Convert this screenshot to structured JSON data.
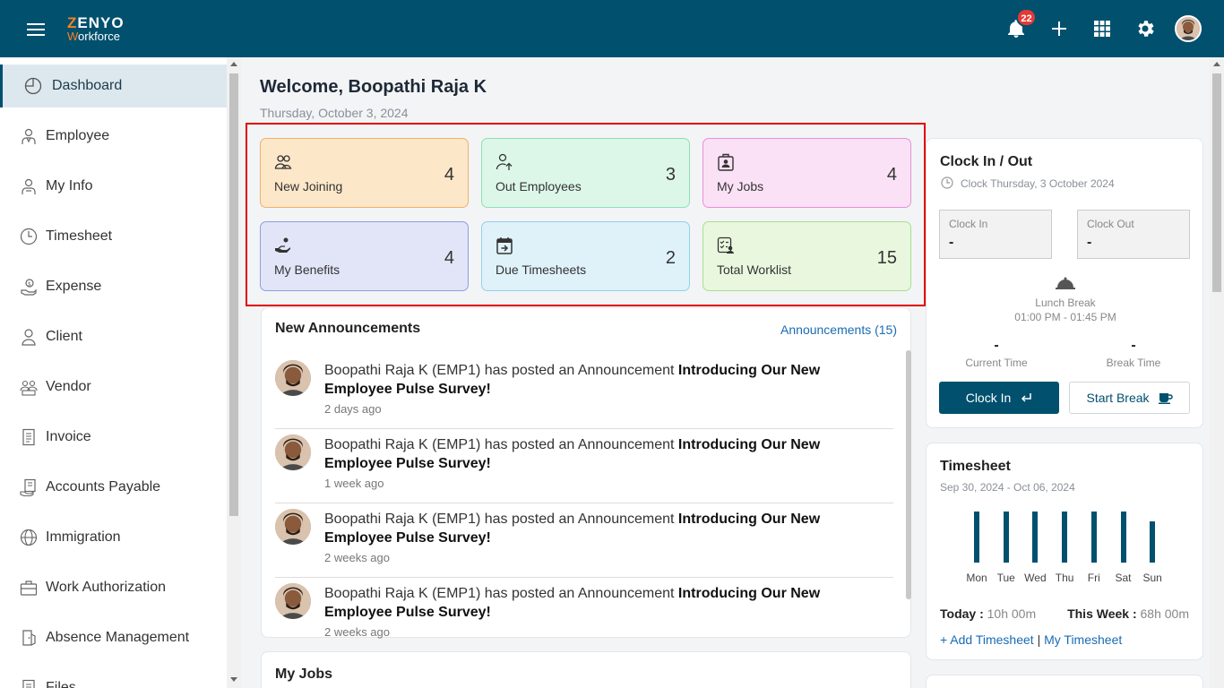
{
  "app": {
    "brand_top": "ZENYO",
    "brand_bottom": "Workforce",
    "notification_count": "22"
  },
  "icons": {
    "menu": "hamburger-icon",
    "bell": "bell-icon",
    "add": "plus-icon",
    "apps": "apps-grid-icon",
    "settings": "gear-icon"
  },
  "colors": {
    "primary": "#00506e",
    "accent": "#f58220",
    "badge": "#e53935",
    "highlight": "#e00000"
  },
  "sidebar": {
    "items": [
      {
        "label": "Dashboard",
        "icon": "dashboard-icon",
        "active": true
      },
      {
        "label": "Employee",
        "icon": "employee-icon"
      },
      {
        "label": "My Info",
        "icon": "my-info-icon"
      },
      {
        "label": "Timesheet",
        "icon": "clock-icon"
      },
      {
        "label": "Expense",
        "icon": "expense-icon"
      },
      {
        "label": "Client",
        "icon": "user-icon"
      },
      {
        "label": "Vendor",
        "icon": "vendor-icon"
      },
      {
        "label": "Invoice",
        "icon": "invoice-icon"
      },
      {
        "label": "Accounts Payable",
        "icon": "accounts-payable-icon"
      },
      {
        "label": "Immigration",
        "icon": "globe-icon"
      },
      {
        "label": "Work Authorization",
        "icon": "briefcase-icon"
      },
      {
        "label": "Absence Management",
        "icon": "door-icon"
      },
      {
        "label": "Files",
        "icon": "files-icon"
      }
    ]
  },
  "main": {
    "welcome": "Welcome, Boopathi Raja K",
    "date": "Thursday, October 3, 2024",
    "stats": [
      {
        "label": "New Joining",
        "value": "4",
        "icon": "group-icon",
        "bg": "#fde7c9",
        "border": "#f1b06a"
      },
      {
        "label": "Out Employees",
        "value": "3",
        "icon": "user-out-icon",
        "bg": "#dcf7e8",
        "border": "#8ee0b3"
      },
      {
        "label": "My Jobs",
        "value": "4",
        "icon": "id-badge-icon",
        "bg": "#fbe1f5",
        "border": "#e98fd8"
      },
      {
        "label": "My Benefits",
        "value": "4",
        "icon": "hand-coin-icon",
        "bg": "#e1e5f7",
        "border": "#8e9ee0"
      },
      {
        "label": "Due Timesheets",
        "value": "2",
        "icon": "calendar-icon",
        "bg": "#dff1f9",
        "border": "#8fd3ea"
      },
      {
        "label": "Total Worklist",
        "value": "15",
        "icon": "worklist-icon",
        "bg": "#e9f7df",
        "border": "#a7e08c"
      }
    ],
    "announcements": {
      "title": "New Announcements",
      "link": "Announcements (15)",
      "items": [
        {
          "prefix": "Boopathi Raja K (EMP1) has posted an Announcement",
          "subject": "Introducing Our New Employee Pulse Survey!",
          "ago": "2 days ago"
        },
        {
          "prefix": "Boopathi Raja K (EMP1) has posted an Announcement",
          "subject": "Introducing Our New Employee Pulse Survey!",
          "ago": "1 week ago"
        },
        {
          "prefix": "Boopathi Raja K (EMP1) has posted an Announcement",
          "subject": "Introducing Our New Employee Pulse Survey!",
          "ago": "2 weeks ago"
        },
        {
          "prefix": "Boopathi Raja K (EMP1) has posted an Announcement",
          "subject": "Introducing Our New Employee Pulse Survey!",
          "ago": "2 weeks ago"
        }
      ]
    },
    "my_jobs_title": "My Jobs"
  },
  "clock": {
    "title": "Clock In / Out",
    "subtitle": "Clock Thursday, 3 October 2024",
    "clock_in_label": "Clock In",
    "clock_in_value": "-",
    "clock_out_label": "Clock Out",
    "clock_out_value": "-",
    "lunch_label": "Lunch Break",
    "lunch_time": "01:00 PM - 01:45 PM",
    "current_time_value": "-",
    "current_time_label": "Current Time",
    "break_time_value": "-",
    "break_time_label": "Break Time",
    "clock_in_button": "Clock In",
    "start_break_button": "Start Break"
  },
  "timesheet": {
    "title": "Timesheet",
    "range": "Sep 30, 2024 - Oct 06, 2024",
    "today_label": "Today :",
    "today_value": "10h 00m",
    "week_label": "This Week :",
    "week_value": "68h 00m",
    "add_link": "+ Add Timesheet",
    "separator": "|",
    "my_link": "My Timesheet"
  },
  "chart_data": {
    "type": "bar",
    "categories": [
      "Mon",
      "Tue",
      "Wed",
      "Thu",
      "Fri",
      "Sat",
      "Sun"
    ],
    "values": [
      10,
      10,
      10,
      10,
      10,
      10,
      8
    ],
    "ylim": [
      0,
      10
    ],
    "grid": false
  }
}
